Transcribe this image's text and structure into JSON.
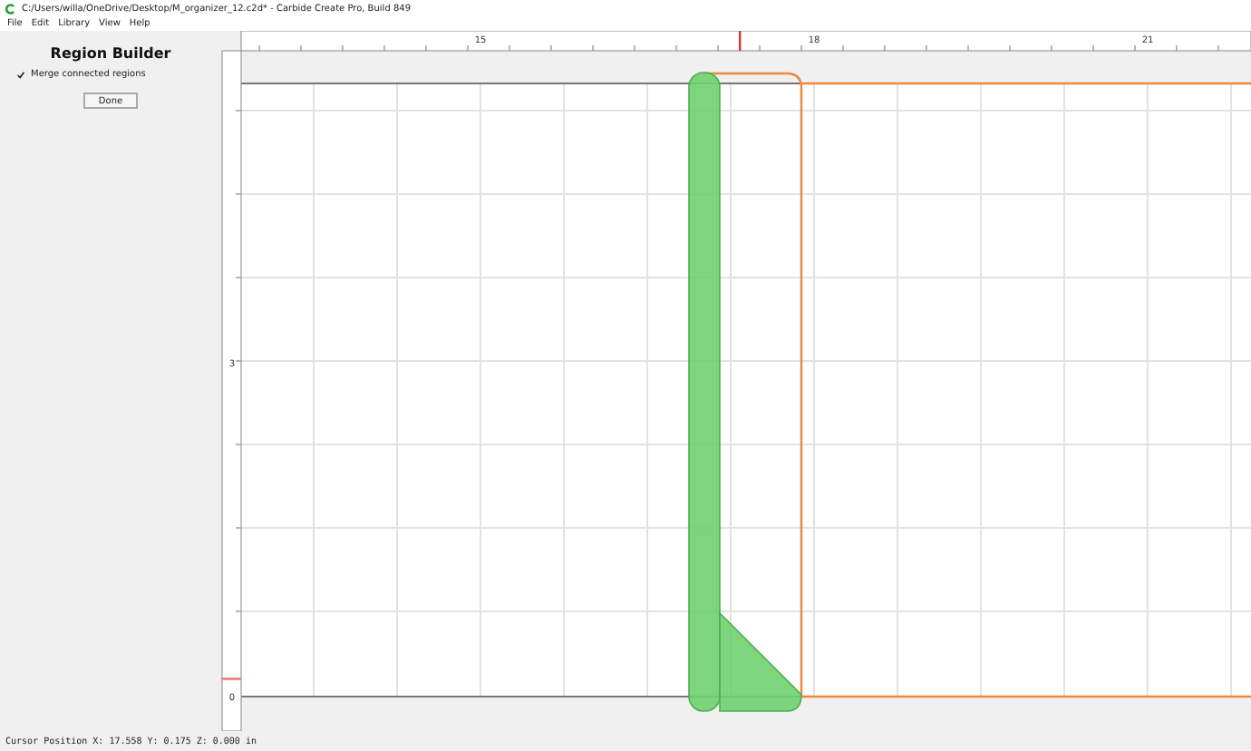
{
  "window": {
    "title": "C:/Users/willa/OneDrive/Desktop/M_organizer_12.c2d* - Carbide Create Pro, Build 849"
  },
  "menu": [
    "File",
    "Edit",
    "Library",
    "View",
    "Help"
  ],
  "panel": {
    "title": "Region Builder",
    "checkbox": {
      "label": "Merge connected regions",
      "checked": true
    },
    "button": "Done"
  },
  "rulers": {
    "top_labels": [
      "15",
      "18",
      "21"
    ],
    "left_labels": [
      "3",
      "0"
    ]
  },
  "status_bar": "Cursor Position X: 17.558 Y: 0.175 Z: 0.000 in"
}
